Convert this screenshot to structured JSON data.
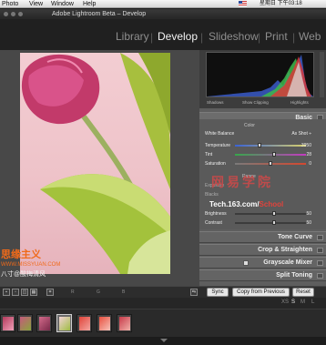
{
  "menubar": {
    "items": [
      "Photo",
      "View",
      "Window",
      "Help"
    ],
    "clock": "星期日 下午03:18"
  },
  "titlebar": {
    "title": "Adobe Lightroom Beta – Develop"
  },
  "modules": {
    "items": [
      "Library",
      "Develop",
      "Slideshow",
      "Print",
      "Web"
    ],
    "active": "Develop"
  },
  "histogram": {
    "labels": [
      "Shadows",
      "Show Clipping",
      "Highlights"
    ]
  },
  "basic": {
    "title": "Basic",
    "color_label": "Color",
    "white_balance_label": "White Balance",
    "white_balance_value": "As Shot ÷",
    "rows": [
      {
        "label": "Temperature",
        "value": "3950",
        "level": 0.35
      },
      {
        "label": "Tint",
        "value": "28",
        "level": 0.55
      },
      {
        "label": "Saturation",
        "value": "0",
        "level": 0.5
      }
    ],
    "range_label": "Range",
    "exposure_label": "Exposure",
    "blacks_label": "Blacks",
    "brightness": {
      "label": "Brightness",
      "value": "50",
      "level": 0.55
    },
    "contrast": {
      "label": "Contrast",
      "value": "50",
      "level": 0.55
    }
  },
  "panels": [
    "Tone Curve",
    "Crop & Straighten",
    "Grayscale Mixer",
    "Split Toning"
  ],
  "toolbar": {
    "labels": [
      "R",
      "G",
      "B"
    ],
    "sync": "Sync",
    "copy_from_previous": "Copy from Previous",
    "reset": "Reset"
  },
  "filmstrip": {
    "sizes": [
      "XS",
      "S",
      "M",
      "L"
    ],
    "count": 7
  },
  "watermarks": {
    "left_main": "思缘主义",
    "left_sub": "WWW.MISSYUAN.COM",
    "left_cn": "八寸@酸梅清风",
    "right_main": "网易学院",
    "right_url_a": "Tech.163.com/",
    "right_url_b": "School"
  },
  "colors": {
    "accent": "#e0433c",
    "panel": "#5e5e5e",
    "photo_bg": "#f0c8ce"
  }
}
